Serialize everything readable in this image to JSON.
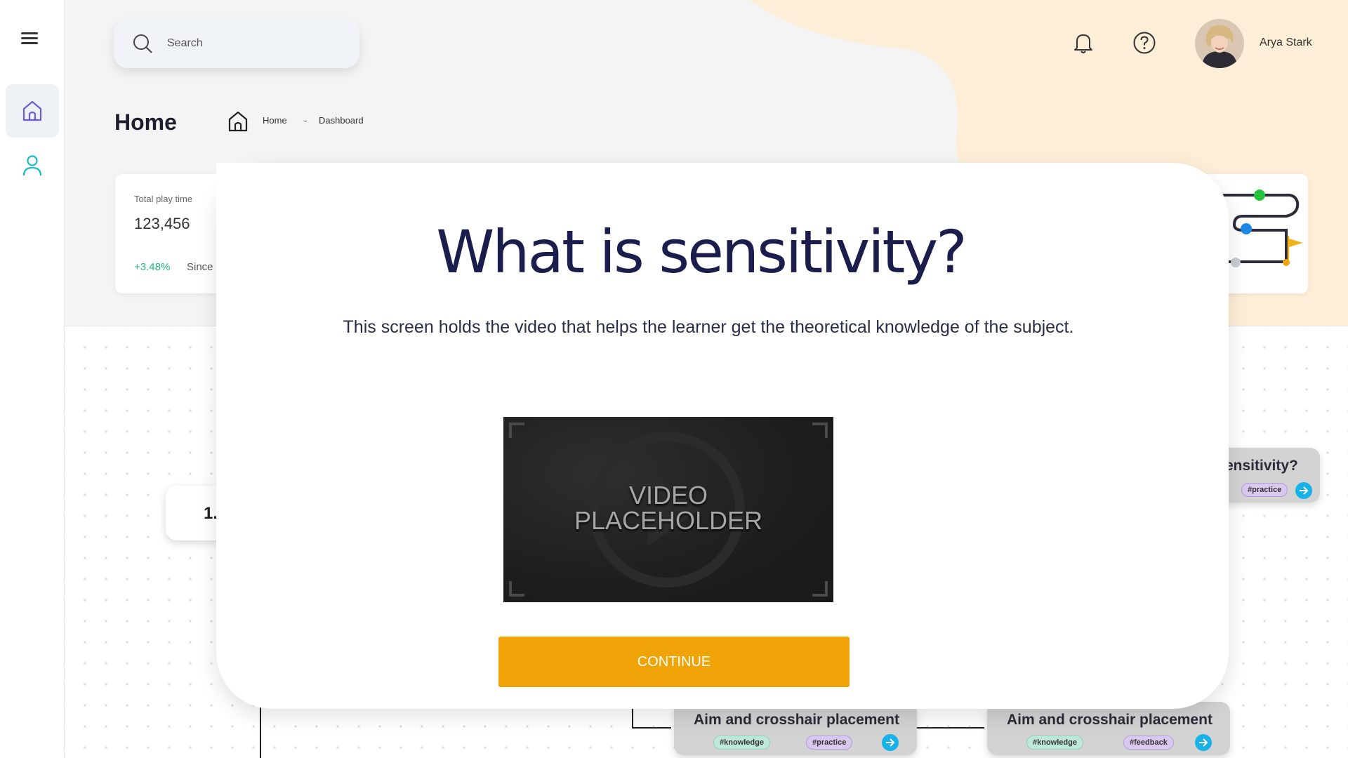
{
  "search": {
    "placeholder": "Search"
  },
  "user": {
    "name": "Arya Stark"
  },
  "page": {
    "title": "Home"
  },
  "breadcrumb": {
    "home": "Home",
    "separator": "-",
    "current": "Dashboard"
  },
  "stat": {
    "label": "Total play time",
    "value": "123,456",
    "change": "+3.48%",
    "since": "Since"
  },
  "modal": {
    "title": "What is sensitivity?",
    "description": "This screen holds the video that helps the learner get the theoretical knowledge of the subject.",
    "video_text_line1": "VIDEO",
    "video_text_line2": "PLACEHOLDER",
    "continue_label": "CONTINUE"
  },
  "flow": {
    "partial_node_label": "1.",
    "right_node": {
      "title": "ensitivity?",
      "tag": "#practice"
    },
    "bottom_node_1": {
      "title": "Aim and crosshair placement",
      "tags": [
        "#knowledge",
        "#practice"
      ]
    },
    "bottom_node_2": {
      "title": "Aim and crosshair placement",
      "tags": [
        "#knowledge",
        "#feedback"
      ]
    }
  },
  "colors": {
    "accent": "#f0a306",
    "title_navy": "#1b1d4d",
    "positive": "#22bb7a",
    "blob": "#fdefd7",
    "go_button": "#17b2e8"
  },
  "icons": [
    "menu-icon",
    "home-icon",
    "user-icon",
    "search-icon",
    "bell-icon",
    "help-icon",
    "play-icon",
    "arrow-right-icon"
  ]
}
